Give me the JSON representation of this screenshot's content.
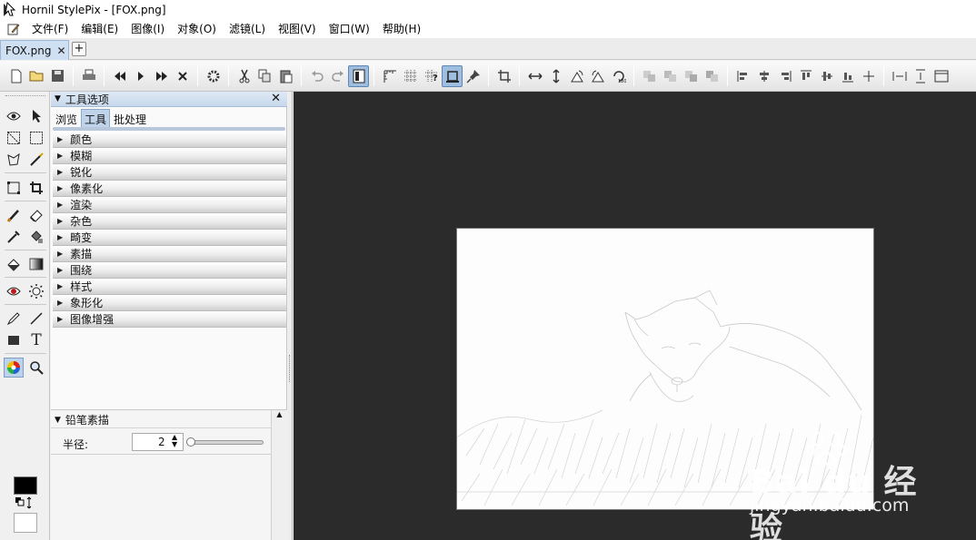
{
  "window": {
    "title": "Hornil StylePix - [FOX.png]"
  },
  "menu": [
    "文件(F)",
    "编辑(E)",
    "图像(I)",
    "对象(O)",
    "滤镜(L)",
    "视图(V)",
    "窗口(W)",
    "帮助(H)"
  ],
  "document_tab": {
    "label": "FOX.png",
    "close": "✕",
    "new_tab": "+"
  },
  "tool_options": {
    "title": "工具选项",
    "close": "✕",
    "tabs": [
      "浏览",
      "工具",
      "批处理"
    ],
    "active_tab": "工具",
    "filters": [
      "颜色",
      "模糊",
      "锐化",
      "像素化",
      "渲染",
      "杂色",
      "畸变",
      "素描",
      "围绕",
      "样式",
      "象形化",
      "图像增强"
    ]
  },
  "pencil_sketch": {
    "title": "铅笔素描",
    "radius_label": "半径:",
    "radius_value": "2",
    "radius_slider_fraction": 0.0
  },
  "colors": {
    "foreground": "#000000",
    "background": "#ffffff",
    "workspace": "#2b2b2b"
  },
  "watermark": {
    "brand": "Bai du 经验",
    "url": "jingyan.baidu.com"
  }
}
